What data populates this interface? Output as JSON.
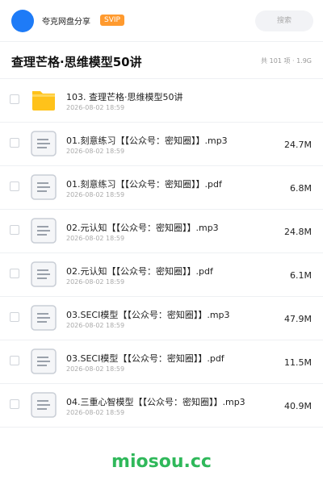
{
  "header": {
    "app_name": "夸克网盘分享",
    "badge": "SVIP",
    "search_placeholder": "搜索",
    "accent_color": "#1e7bf7"
  },
  "folder": {
    "title": "查理芒格·思维模型50讲",
    "summary": "共 101 项 · 1.9G"
  },
  "files": [
    {
      "icon": "folder-icon",
      "name": "103. 查理芒格·思维模型50讲",
      "date": "2026-08-02 18:59",
      "size": ""
    },
    {
      "icon": "document-icon",
      "name": "01.刻意练习【【公众号：密知圈】】.mp3",
      "date": "2026-08-02 18:59",
      "size": "24.7M"
    },
    {
      "icon": "document-icon",
      "name": "01.刻意练习【【公众号：密知圈】】.pdf",
      "date": "2026-08-02 18:59",
      "size": "6.8M"
    },
    {
      "icon": "document-icon",
      "name": "02.元认知【【公众号：密知圈】】.mp3",
      "date": "2026-08-02 18:59",
      "size": "24.8M"
    },
    {
      "icon": "document-icon",
      "name": "02.元认知【【公众号：密知圈】】.pdf",
      "date": "2026-08-02 18:59",
      "size": "6.1M"
    },
    {
      "icon": "document-icon",
      "name": "03.SECI模型【【公众号：密知圈】】.mp3",
      "date": "2026-08-02 18:59",
      "size": "47.9M"
    },
    {
      "icon": "document-icon",
      "name": "03.SECI模型【【公众号：密知圈】】.pdf",
      "date": "2026-08-02 18:59",
      "size": "11.5M"
    },
    {
      "icon": "document-icon",
      "name": "04.三重心智模型【【公众号：密知圈】】.mp3",
      "date": "2026-08-02 18:59",
      "size": "40.9M"
    }
  ],
  "watermark": "miosou.cc"
}
